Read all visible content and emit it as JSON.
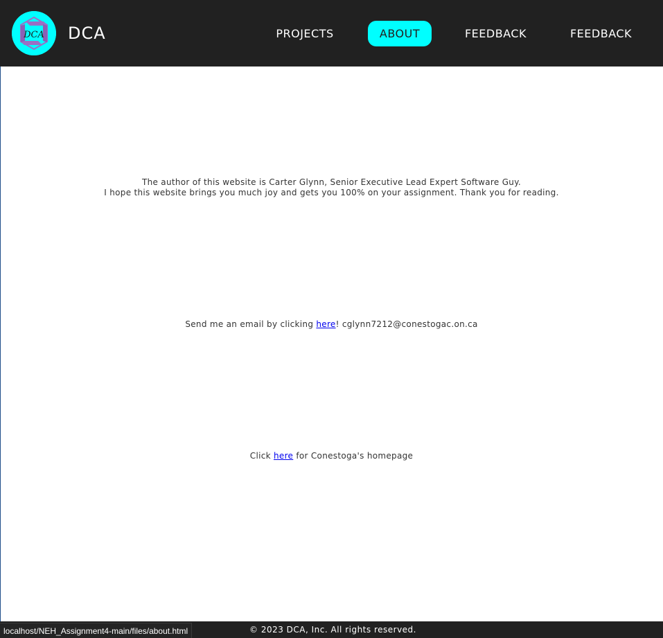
{
  "header": {
    "brand": "DCA",
    "logo_text": "DCA",
    "nav": [
      {
        "label": "PROJECTS",
        "active": false
      },
      {
        "label": "ABOUT",
        "active": true
      },
      {
        "label": "FEEDBACK",
        "active": false
      },
      {
        "label": "FEEDBACK",
        "active": false
      }
    ]
  },
  "main": {
    "about_line_1": "The author of this website is Carter Glynn, Senior Executive Lead Expert Software Guy.",
    "about_line_2": "I hope this website brings you much joy and gets you 100% on your assignment. Thank you for reading.",
    "email_prefix": "Send me an email by clicking ",
    "email_link": "here",
    "email_suffix": "! cglynn7212@conestogac.on.ca",
    "home_prefix": "Click ",
    "home_link": "here",
    "home_suffix": " for Conestoga's homepage"
  },
  "footer": {
    "copyright": "© 2023 DCA, Inc. All rights reserved."
  },
  "status_bar": {
    "url": "localhost/NEH_Assignment4-main/files/about.html"
  },
  "colors": {
    "header_bg": "#212121",
    "accent": "#00ffff",
    "logo_purple": "#9b6fc4",
    "link": "#0000ee",
    "text": "#333333"
  },
  "icons": {
    "logo": "dca-logo-icon"
  }
}
